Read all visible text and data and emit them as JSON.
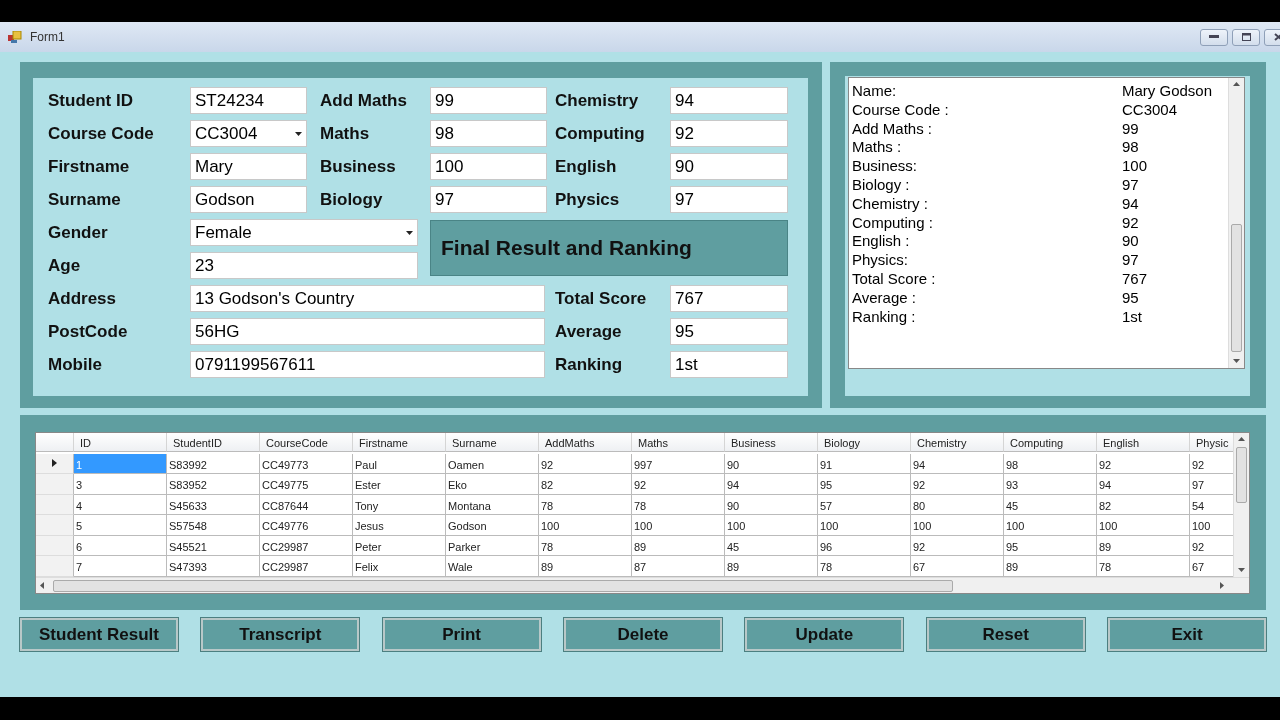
{
  "window": {
    "title": "Form1"
  },
  "student_fields": [
    {
      "label": "Student ID",
      "value": "ST24234",
      "kind": "text"
    },
    {
      "label": "Course Code",
      "value": "CC3004",
      "kind": "combo"
    },
    {
      "label": "Firstname",
      "value": "Mary",
      "kind": "text"
    },
    {
      "label": "Surname",
      "value": "Godson",
      "kind": "text"
    },
    {
      "label": "Gender",
      "value": "Female",
      "kind": "combo"
    },
    {
      "label": "Age",
      "value": "23",
      "kind": "text"
    },
    {
      "label": "Address",
      "value": "13 Godson's Country",
      "kind": "text"
    },
    {
      "label": "PostCode",
      "value": "56HG",
      "kind": "text"
    },
    {
      "label": "Mobile",
      "value": "0791199567611",
      "kind": "text"
    }
  ],
  "subject_scores": [
    {
      "label": "Add Maths",
      "value": "99"
    },
    {
      "label": "Maths",
      "value": "98"
    },
    {
      "label": "Business",
      "value": "100"
    },
    {
      "label": "Biology",
      "value": "97"
    },
    {
      "label": "Chemistry",
      "value": "94"
    },
    {
      "label": "Computing",
      "value": "92"
    },
    {
      "label": "English",
      "value": "90"
    },
    {
      "label": "Physics",
      "value": "97"
    }
  ],
  "result_heading": "Final Result and Ranking",
  "result_fields": [
    {
      "label": "Total Score",
      "value": "767"
    },
    {
      "label": "Average",
      "value": "95"
    },
    {
      "label": "Ranking",
      "value": "1st"
    }
  ],
  "transcript": [
    {
      "label": "Name:",
      "value": "Mary Godson"
    },
    {
      "label": "Course Code :",
      "value": "CC3004"
    },
    {
      "label": "Add Maths :",
      "value": "99"
    },
    {
      "label": "Maths :",
      "value": "98"
    },
    {
      "label": "Business:",
      "value": "100"
    },
    {
      "label": "Biology :",
      "value": "97"
    },
    {
      "label": "Chemistry :",
      "value": "94"
    },
    {
      "label": "Computing :",
      "value": "92"
    },
    {
      "label": "English :",
      "value": "90"
    },
    {
      "label": "Physics:",
      "value": "97"
    },
    {
      "label": "Total Score :",
      "value": "767"
    },
    {
      "label": "Average :",
      "value": "95"
    },
    {
      "label": "Ranking :",
      "value": "1st"
    }
  ],
  "grid": {
    "columns": [
      "ID",
      "StudentID",
      "CourseCode",
      "Firstname",
      "Surname",
      "AddMaths",
      "Maths",
      "Business",
      "Biology",
      "Chemistry",
      "Computing",
      "English",
      "Physic"
    ],
    "rows": [
      {
        "selected": true,
        "cells": [
          "1",
          "S83992",
          "CC49773",
          "Paul",
          "Oamen",
          "92",
          "997",
          "90",
          "91",
          "94",
          "98",
          "92",
          "92"
        ]
      },
      {
        "selected": false,
        "cells": [
          "3",
          "S83952",
          "CC49775",
          "Ester",
          "Eko",
          "82",
          "92",
          "94",
          "95",
          "92",
          "93",
          "94",
          "97"
        ]
      },
      {
        "selected": false,
        "cells": [
          "4",
          "S45633",
          "CC87644",
          "Tony",
          "Montana",
          "78",
          "78",
          "90",
          "57",
          "80",
          "45",
          "82",
          "54"
        ]
      },
      {
        "selected": false,
        "cells": [
          "5",
          "S57548",
          "CC49776",
          "Jesus",
          "Godson",
          "100",
          "100",
          "100",
          "100",
          "100",
          "100",
          "100",
          "100"
        ]
      },
      {
        "selected": false,
        "cells": [
          "6",
          "S45521",
          "CC29987",
          "Peter",
          "Parker",
          "78",
          "89",
          "45",
          "96",
          "92",
          "95",
          "89",
          "92"
        ]
      },
      {
        "selected": false,
        "cells": [
          "7",
          "S47393",
          "CC29987",
          "Felix",
          "Wale",
          "89",
          "87",
          "89",
          "78",
          "67",
          "89",
          "78",
          "67"
        ]
      }
    ]
  },
  "buttons": [
    "Student Result",
    "Transcript",
    "Print",
    "Delete",
    "Update",
    "Reset",
    "Exit"
  ]
}
